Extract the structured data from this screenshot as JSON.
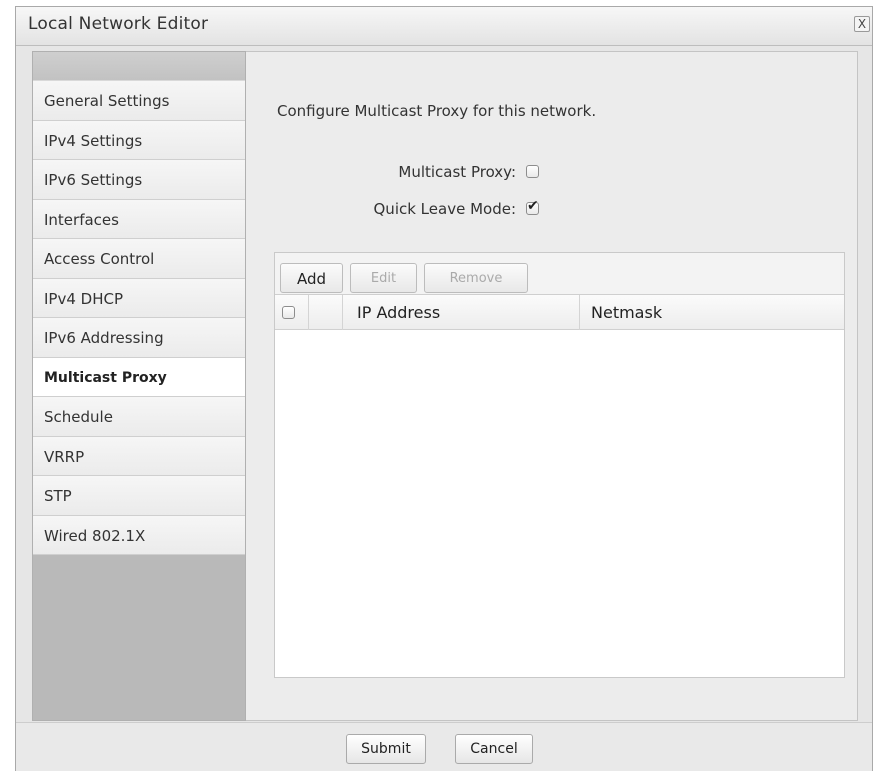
{
  "window": {
    "title": "Local Network Editor",
    "close_label": "X"
  },
  "sidebar": {
    "items": [
      {
        "label": "General Settings",
        "active": false
      },
      {
        "label": "IPv4 Settings",
        "active": false
      },
      {
        "label": "IPv6 Settings",
        "active": false
      },
      {
        "label": "Interfaces",
        "active": false
      },
      {
        "label": "Access Control",
        "active": false
      },
      {
        "label": "IPv4 DHCP",
        "active": false
      },
      {
        "label": "IPv6 Addressing",
        "active": false
      },
      {
        "label": "Multicast Proxy",
        "active": true
      },
      {
        "label": "Schedule",
        "active": false
      },
      {
        "label": "VRRP",
        "active": false
      },
      {
        "label": "STP",
        "active": false
      },
      {
        "label": "Wired 802.1X",
        "active": false
      }
    ]
  },
  "main": {
    "description": "Configure Multicast Proxy for this network.",
    "multicast_proxy": {
      "label": "Multicast Proxy:",
      "checked": false
    },
    "quick_leave_mode": {
      "label": "Quick Leave Mode:",
      "checked": true
    },
    "toolbar": {
      "add_label": "Add",
      "edit_label": "Edit",
      "remove_label": "Remove"
    },
    "table": {
      "columns": [
        "IP Address",
        "Netmask"
      ],
      "rows": []
    }
  },
  "footer": {
    "submit_label": "Submit",
    "cancel_label": "Cancel"
  }
}
